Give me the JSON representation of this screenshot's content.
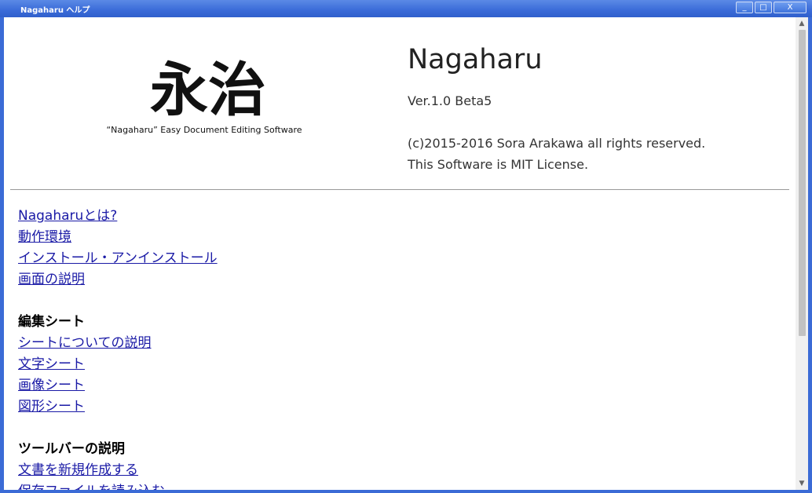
{
  "window": {
    "title": "Nagaharu ヘルプ",
    "buttons": [
      "_",
      "□",
      "X"
    ]
  },
  "header": {
    "logo_text": "永治",
    "logo_caption": "“Nagaharu” Easy Document Editing Software",
    "app_name": "Nagaharu",
    "version": "Ver.1.0 Beta5",
    "copyright": "(c)2015-2016 Sora Arakawa all rights reserved.",
    "license": "This Software is MIT License."
  },
  "nav": {
    "group1": [
      "Nagaharuとは?",
      "動作環境",
      "インストール・アンインストール",
      "画面の説明"
    ],
    "heading2": "編集シート",
    "group2": [
      "シートについての説明",
      "文字シート",
      "画像シート",
      "図形シート"
    ],
    "heading3": "ツールバーの説明",
    "group3": [
      "文書を新規作成する",
      "保存ファイルを読み込む"
    ]
  }
}
